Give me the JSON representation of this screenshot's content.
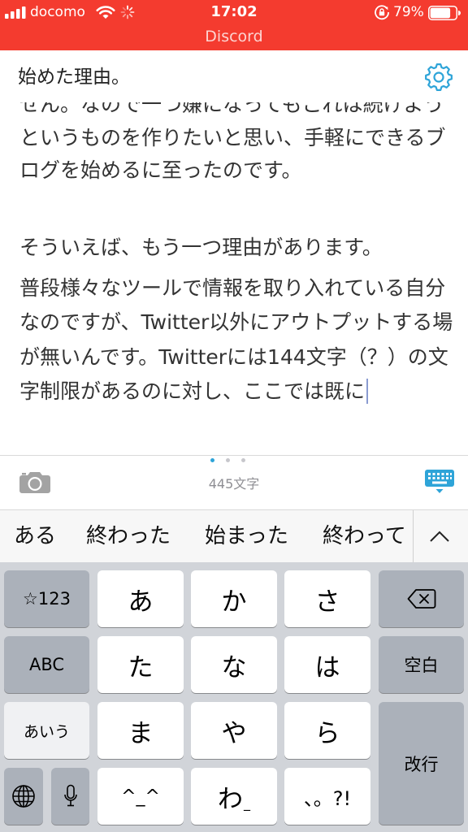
{
  "status_bar": {
    "carrier": "docomo",
    "time": "17:02",
    "battery": "79%"
  },
  "return_bar": {
    "label": "Discord"
  },
  "editor": {
    "title": "始めた理由。",
    "body_lines": [
      "せん。なので一つ嫌になってもこれは続けよう",
      "というものを作りたいと思い、手軽にできるブ",
      "ログを始めるに至ったのです。",
      "そういえば、もう一つ理由があります。",
      "普段様々なツールで情報を取り入れている自分",
      "なのですが、Twitter以外にアウトプットする場",
      "が無いんです。Twitterには144文字（？）の文",
      "字制限があるのに対し、ここでは既に"
    ]
  },
  "toolbar": {
    "char_count": "445文字",
    "page_count": 3,
    "active_page": 0
  },
  "predictions": [
    "ある",
    "終わった",
    "始まった",
    "終わって"
  ],
  "keyboard": {
    "key_123": "☆123",
    "key_abc": "ABC",
    "key_kana": "あいう",
    "a": "あ",
    "ka": "か",
    "sa": "さ",
    "ta": "た",
    "na": "な",
    "ha": "は",
    "ma": "ま",
    "ya": "や",
    "ra": "ら",
    "kaomoji": "^_^",
    "wa": "わ",
    "wa_sub": "_",
    "punct": "、。?!",
    "space": "空白",
    "return": "改行"
  },
  "colors": {
    "status_bar": "#f43b2f",
    "accent": "#2ea4d8",
    "keyboard_bg": "#d1d4d9",
    "key": "#ffffff",
    "function_key": "#abb1ba",
    "text": "#2b2b2b",
    "muted": "#8e8e93"
  },
  "icons": {
    "signal": "signal-icon",
    "wifi": "wifi-icon",
    "activity": "spinner-icon",
    "rotation_lock": "orientation-lock-icon",
    "battery": "battery-icon",
    "settings": "gear-icon",
    "camera": "camera-icon",
    "hide_keyboard": "keyboard-hide-icon",
    "collapse_predictions": "chevron-up-icon",
    "delete": "backspace-icon",
    "globe": "globe-icon",
    "dictation": "mic-icon"
  }
}
